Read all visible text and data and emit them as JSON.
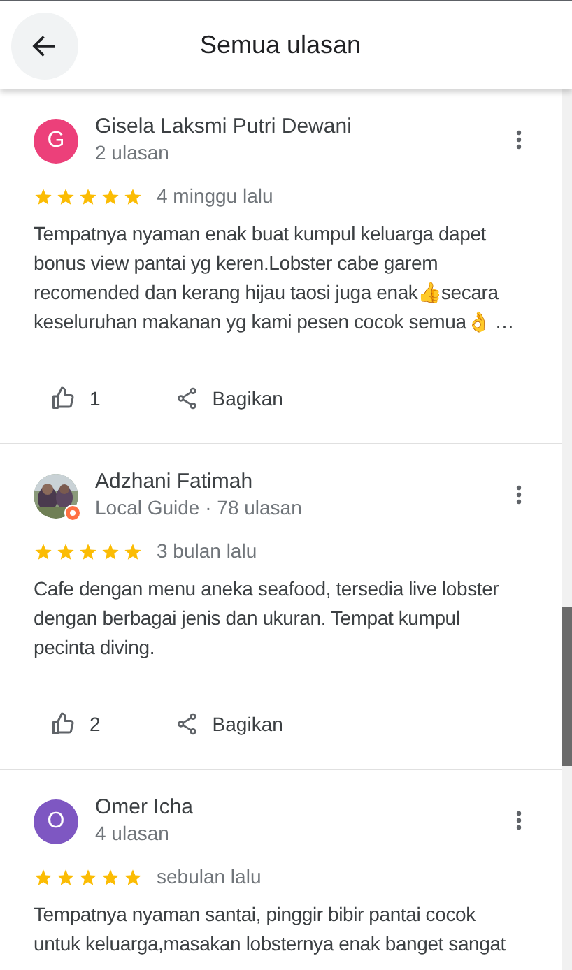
{
  "header": {
    "title": "Semua ulasan"
  },
  "reviews": [
    {
      "avatar": {
        "kind": "letter",
        "letter": "G",
        "color": "#ec407a"
      },
      "name": "Gisela Laksmi Putri Dewani",
      "meta": "2 ulasan",
      "stars": 5,
      "time": "4 minggu lalu",
      "text": "Tempatnya nyaman enak buat kumpul keluarga dapet bonus view pantai yg keren.Lobster cabe garem recomended dan kerang hijau taosi juga enak👍secara keseluruhan makanan yg kami pesen cocok semua👌 …",
      "likes": "1",
      "share": "Bagikan"
    },
    {
      "avatar": {
        "kind": "picture",
        "local_guide": true
      },
      "name": "Adzhani Fatimah",
      "meta": "Local Guide · 78 ulasan",
      "stars": 5,
      "time": "3 bulan lalu",
      "text": "Cafe dengan menu aneka seafood, tersedia live lobster dengan berbagai jenis dan ukuran.  Tempat kumpul pecinta diving.",
      "likes": "2",
      "share": "Bagikan"
    },
    {
      "avatar": {
        "kind": "letter",
        "letter": "O",
        "color": "#7e57c2"
      },
      "name": "Omer Icha",
      "meta": "4 ulasan",
      "stars": 5,
      "time": "sebulan lalu",
      "text": "Tempatnya nyaman santai, pinggir bibir pantai cocok untuk keluarga,masakan lobsternya enak banget sangat"
    }
  ]
}
